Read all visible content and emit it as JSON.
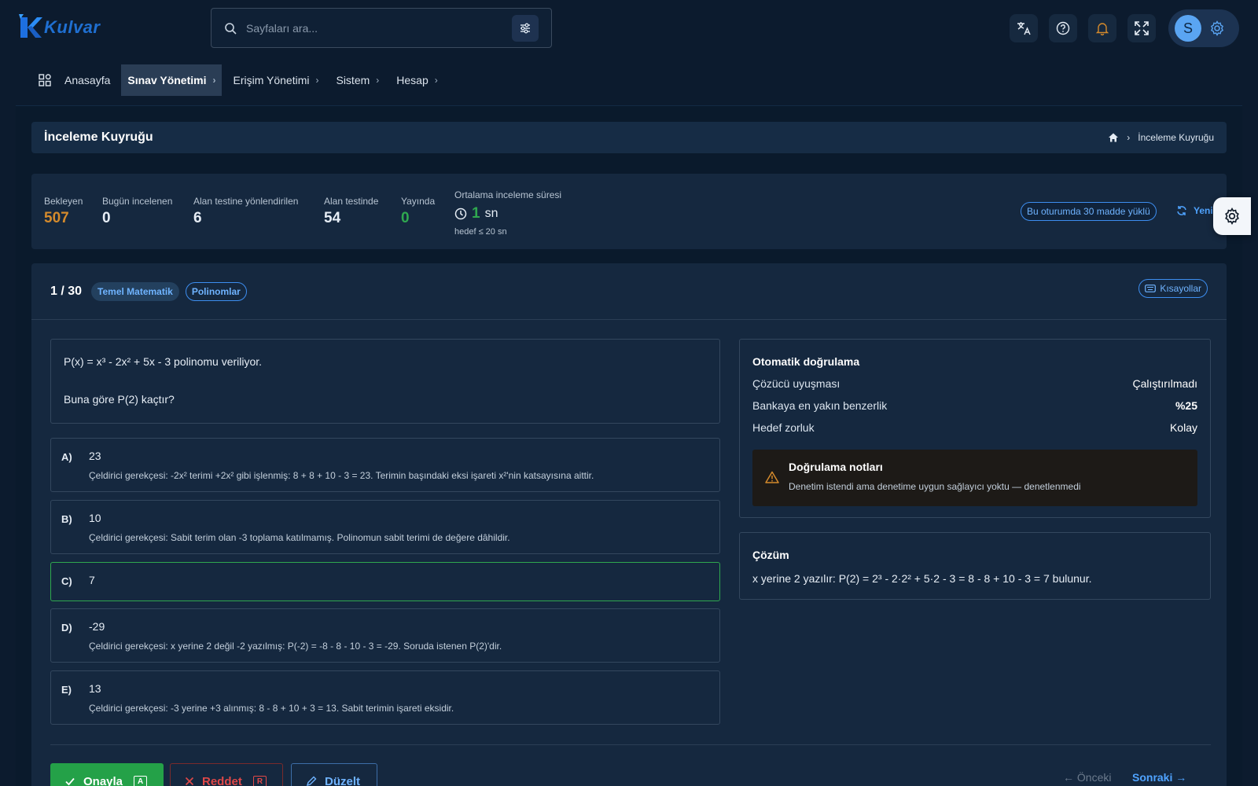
{
  "app": {
    "logo_text": "Kulvar"
  },
  "search": {
    "placeholder": "Sayfaları ara..."
  },
  "nav": {
    "items": [
      {
        "label": "Anasayfa"
      },
      {
        "label": "Sınav Yönetimi"
      },
      {
        "label": "Erişim Yönetimi"
      },
      {
        "label": "Sistem"
      },
      {
        "label": "Hesap"
      }
    ]
  },
  "user": {
    "initial": "S"
  },
  "page": {
    "title": "İnceleme Kuyruğu",
    "breadcrumb_current": "İnceleme Kuyruğu"
  },
  "stats": {
    "pending": {
      "label": "Bekleyen",
      "value": "507"
    },
    "reviewed_today": {
      "label": "Bugün incelenen",
      "value": "0"
    },
    "sent_to_field": {
      "label": "Alan testine yönlendirilen",
      "value": "6"
    },
    "in_field_test": {
      "label": "Alan testinde",
      "value": "54"
    },
    "published": {
      "label": "Yayında",
      "value": "0"
    },
    "avg_time": {
      "label": "Ortalama inceleme süresi",
      "value": "1",
      "unit": "sn",
      "target": "hedef ≤ 20 sn"
    },
    "session_badge": "Bu oturumda 30 madde yüklü",
    "refresh_label": "Yenile"
  },
  "colors": {
    "pending": "#d48a2c",
    "published": "#2fa84f",
    "accent": "#4fa3ff",
    "approve": "#24a148",
    "reject": "#e04848"
  },
  "item": {
    "counter": "1 / 30",
    "tags": [
      "Temel Matematik",
      "Polinomlar"
    ],
    "shortcuts_label": "Kısayollar",
    "question_lines": [
      "P(x) = x³ - 2x² + 5x - 3 polinomu veriliyor.",
      "Buna göre P(2) kaçtır?"
    ],
    "options": [
      {
        "letter": "A)",
        "value": "23",
        "reason": "Çeldirici gerekçesi: -2x² terimi +2x² gibi işlenmiş: 8 + 8 + 10 - 3 = 23. Terimin başındaki eksi işareti x²'nin katsayısına aittir."
      },
      {
        "letter": "B)",
        "value": "10",
        "reason": "Çeldirici gerekçesi: Sabit terim olan -3 toplama katılmamış. Polinomun sabit terimi de değere dâhildir."
      },
      {
        "letter": "C)",
        "value": "7",
        "reason": ""
      },
      {
        "letter": "D)",
        "value": "-29",
        "reason": "Çeldirici gerekçesi: x yerine 2 değil -2 yazılmış: P(-2) = -8 - 8 - 10 - 3 = -29. Soruda istenen P(2)'dir."
      },
      {
        "letter": "E)",
        "value": "13",
        "reason": "Çeldirici gerekçesi: -3 yerine +3 alınmış: 8 - 8 + 10 + 3 = 13. Sabit terimin işareti eksidir."
      }
    ],
    "correct_option": "C)"
  },
  "verification": {
    "title": "Otomatik doğrulama",
    "rows": [
      {
        "label": "Çözücü uyuşması",
        "value": "Çalıştırılmadı"
      },
      {
        "label": "Bankaya en yakın benzerlik",
        "value": "%25"
      },
      {
        "label": "Hedef zorluk",
        "value": "Kolay"
      }
    ],
    "notes_title": "Doğrulama notları",
    "notes_text": "Denetim istendi ama denetime uygun sağlayıcı yoktu — denetlenmedi"
  },
  "solution": {
    "title": "Çözüm",
    "text": "x yerine 2 yazılır: P(2) = 2³ - 2·2² + 5·2 - 3 = 8 - 8 + 10 - 3 = 7 bulunur."
  },
  "actions": {
    "approve": {
      "label": "Onayla",
      "key": "A"
    },
    "reject": {
      "label": "Reddet",
      "key": "R"
    },
    "edit": {
      "label": "Düzelt"
    },
    "prev": "← Önceki",
    "next": "Sonraki →"
  }
}
